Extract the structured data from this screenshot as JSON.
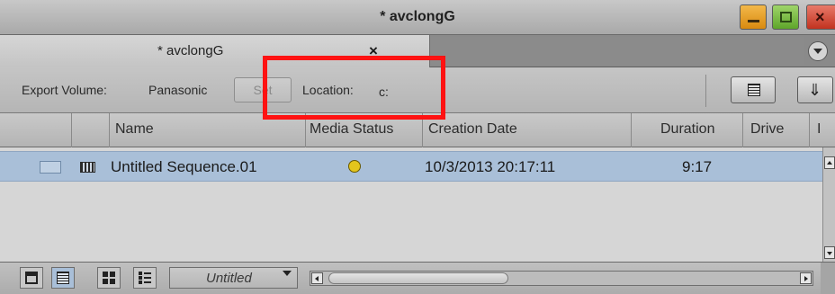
{
  "window": {
    "title": "* avclongG"
  },
  "tab": {
    "title": "* avclongG",
    "close_glyph": "×"
  },
  "toolbar": {
    "export_volume_label": "Export Volume:",
    "export_volume_value": "Panasonic",
    "set_label": "Set",
    "location_label": "Location:",
    "location_value": "c:"
  },
  "columns": [
    "",
    "",
    "Name",
    "Media Status",
    "Creation Date",
    "Duration",
    "Drive",
    "I"
  ],
  "rows": [
    {
      "name": "Untitled Sequence.01",
      "media_status": "yellow-dot",
      "creation_date": "10/3/2013 20:17:11",
      "duration": "9:17",
      "drive": "",
      "selected": true
    }
  ],
  "bottom": {
    "view_name": "Untitled"
  },
  "colors": {
    "highlight": "#ff1212",
    "selection": "#a9bfd8",
    "minimize": "#e7a030",
    "maximize": "#7cc04a",
    "close": "#d64a36",
    "status_yellow": "#e4c51c"
  },
  "icons": {
    "window_buttons": [
      "minimize-icon",
      "maximize-icon",
      "close-icon"
    ],
    "tab_menu": "chevron-down-icon",
    "toolbar": [
      "list-view-icon",
      "export-down-icon"
    ],
    "bottom_views": [
      "frame-view-icon",
      "text-view-icon",
      "frames-grid-icon",
      "script-view-icon"
    ]
  }
}
